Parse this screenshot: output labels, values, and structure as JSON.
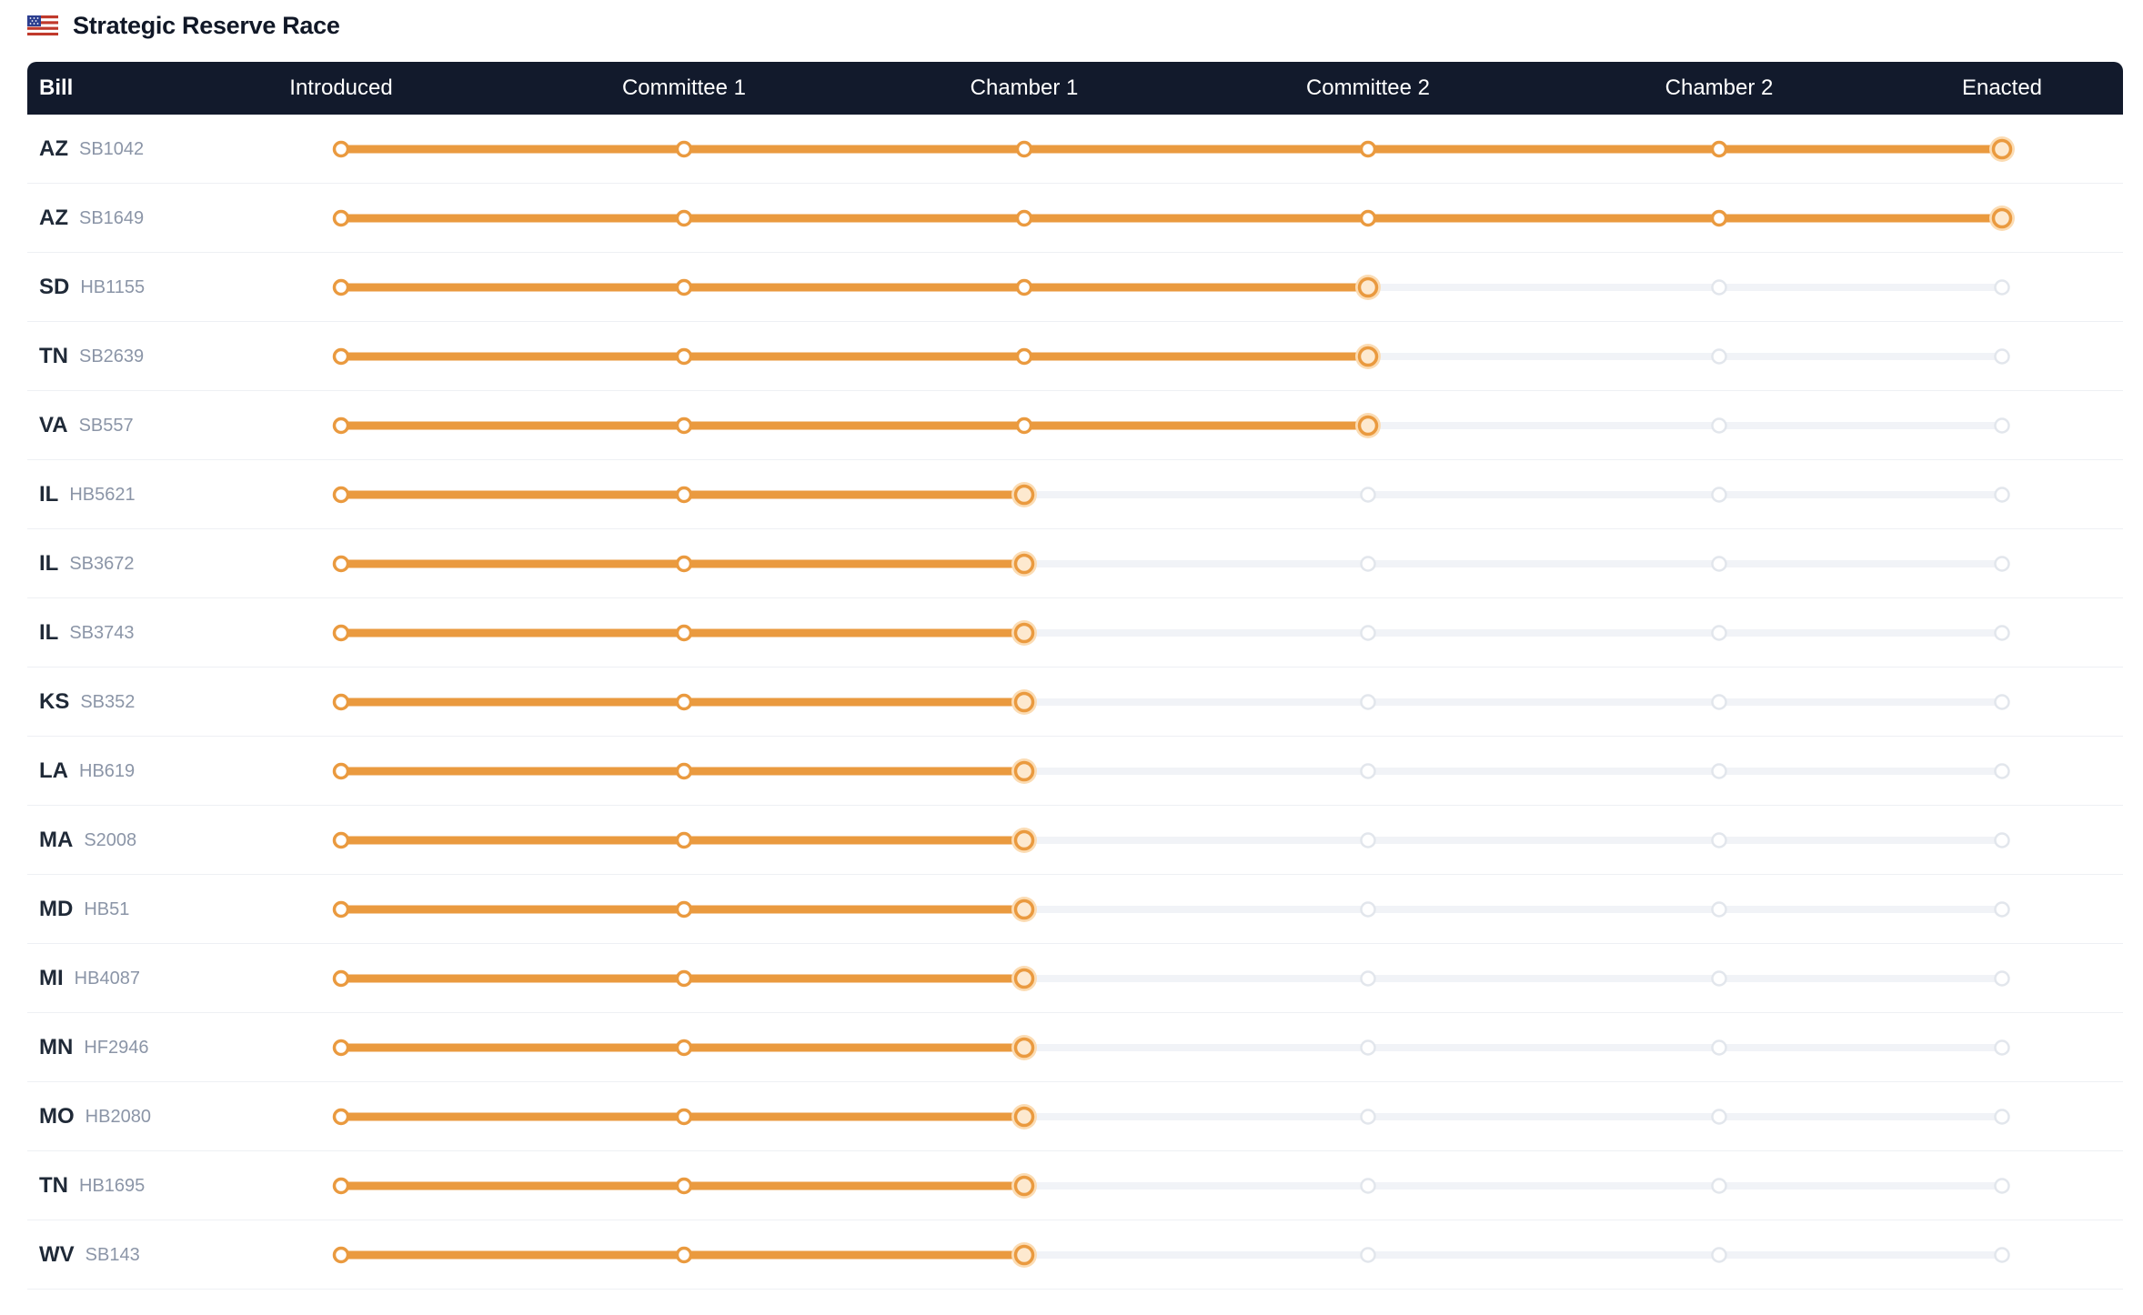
{
  "header": {
    "flag_icon": "us-flag-icon",
    "title": "Strategic Reserve Race"
  },
  "table": {
    "bill_header": "Bill",
    "stages": [
      "Introduced",
      "Committee 1",
      "Chamber 1",
      "Committee 2",
      "Chamber 2",
      "Enacted"
    ],
    "rows": [
      {
        "state": "AZ",
        "bill": "SB1042",
        "stage_reached": 5
      },
      {
        "state": "AZ",
        "bill": "SB1649",
        "stage_reached": 5
      },
      {
        "state": "SD",
        "bill": "HB1155",
        "stage_reached": 3
      },
      {
        "state": "TN",
        "bill": "SB2639",
        "stage_reached": 3
      },
      {
        "state": "VA",
        "bill": "SB557",
        "stage_reached": 3
      },
      {
        "state": "IL",
        "bill": "HB5621",
        "stage_reached": 2
      },
      {
        "state": "IL",
        "bill": "SB3672",
        "stage_reached": 2
      },
      {
        "state": "IL",
        "bill": "SB3743",
        "stage_reached": 2
      },
      {
        "state": "KS",
        "bill": "SB352",
        "stage_reached": 2
      },
      {
        "state": "LA",
        "bill": "HB619",
        "stage_reached": 2
      },
      {
        "state": "MA",
        "bill": "S2008",
        "stage_reached": 2
      },
      {
        "state": "MD",
        "bill": "HB51",
        "stage_reached": 2
      },
      {
        "state": "MI",
        "bill": "HB4087",
        "stage_reached": 2
      },
      {
        "state": "MN",
        "bill": "HF2946",
        "stage_reached": 2
      },
      {
        "state": "MO",
        "bill": "HB2080",
        "stage_reached": 2
      },
      {
        "state": "TN",
        "bill": "HB1695",
        "stage_reached": 2
      },
      {
        "state": "WV",
        "bill": "SB143",
        "stage_reached": 2
      }
    ]
  },
  "colors": {
    "progress": "#ea9a3f",
    "progress_halo": "#fbdcb4",
    "track": "#f1f3f7",
    "inactive_node": "#e2e6ec",
    "header_bg": "#121a2c"
  }
}
